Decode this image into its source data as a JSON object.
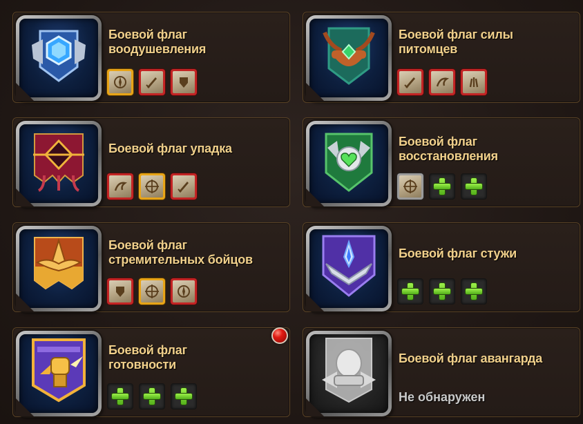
{
  "flags": [
    {
      "title": "Боевой флаг воодушевления",
      "icon": "blue-crystal-banner-icon",
      "slots": [
        "red-gold:compass-scroll",
        "red:sword-scroll",
        "red:shield-scroll"
      ]
    },
    {
      "title": "Боевой флаг силы питомцев",
      "icon": "green-antler-banner-icon",
      "slots": [
        "red:sword-scroll",
        "red:whip-scroll",
        "red:claw-scroll"
      ]
    },
    {
      "title": "Боевой флаг упадка",
      "icon": "crimson-banner-icon",
      "slots": [
        "red:whip-scroll",
        "gold:target-scroll",
        "red:sword-scroll"
      ]
    },
    {
      "title": "Боевой флаг восстановления",
      "icon": "green-heart-banner-icon",
      "slots": [
        "gray:target-scroll",
        "empty",
        "empty"
      ]
    },
    {
      "title": "Боевой флаг стремительных бойцов",
      "icon": "gold-winged-banner-icon",
      "slots": [
        "red:shield-scroll",
        "gold:target-scroll",
        "red:compass-scroll"
      ]
    },
    {
      "title": "Боевой флаг стужи",
      "icon": "purple-frost-banner-icon",
      "slots": [
        "empty",
        "empty",
        "empty"
      ]
    },
    {
      "title": "Боевой флаг готовности",
      "icon": "purple-fist-banner-icon",
      "slots": [
        "empty",
        "empty",
        "empty"
      ],
      "has_notification": true
    },
    {
      "title": "Боевой флаг авангарда",
      "icon": "locked-gray-banner-icon",
      "status": "Не обнаружен"
    }
  ],
  "colors": {
    "title": "#f1d08b",
    "card_border": "#5a4326",
    "slot_red": "#c32424",
    "slot_gold": "#e8a417",
    "plus_green": "#7fd73a",
    "notification": "#e01b12"
  }
}
